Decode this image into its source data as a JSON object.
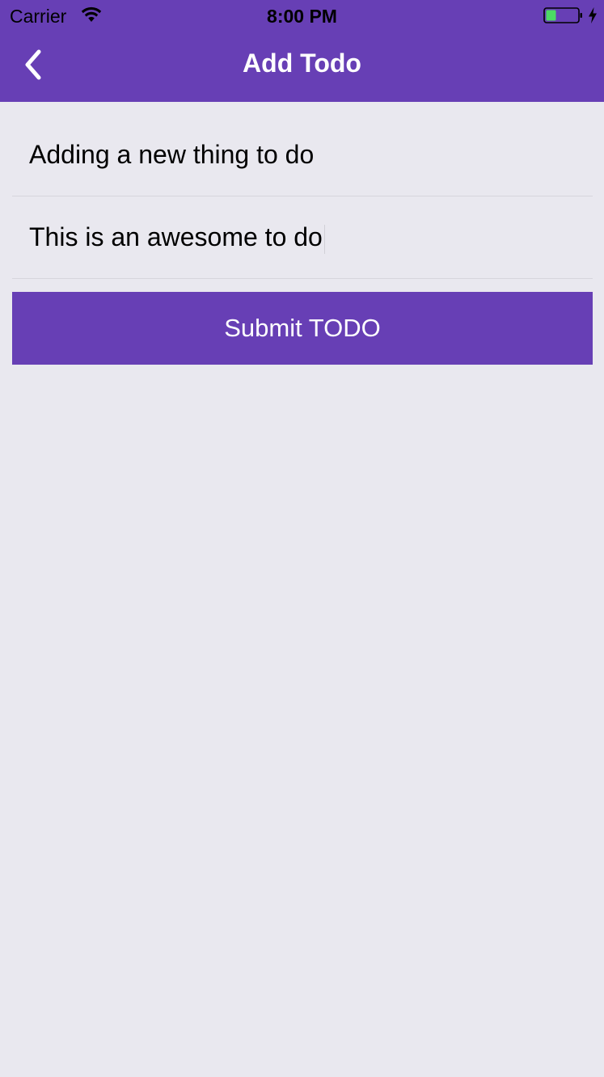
{
  "status_bar": {
    "carrier": "Carrier",
    "time": "8:00 PM",
    "icons": [
      "wifi-icon",
      "battery-icon",
      "charging-icon"
    ],
    "battery_level": 0.3
  },
  "nav": {
    "title": "Add Todo",
    "back_icon": "chevron-left-icon"
  },
  "form": {
    "title_value": "Adding a new thing to do",
    "description_value": "This is an awesome to do",
    "submit_label": "Submit TODO"
  },
  "colors": {
    "accent": "#673fb5",
    "background": "#e9e8ef",
    "battery_fill": "#4cd964"
  }
}
